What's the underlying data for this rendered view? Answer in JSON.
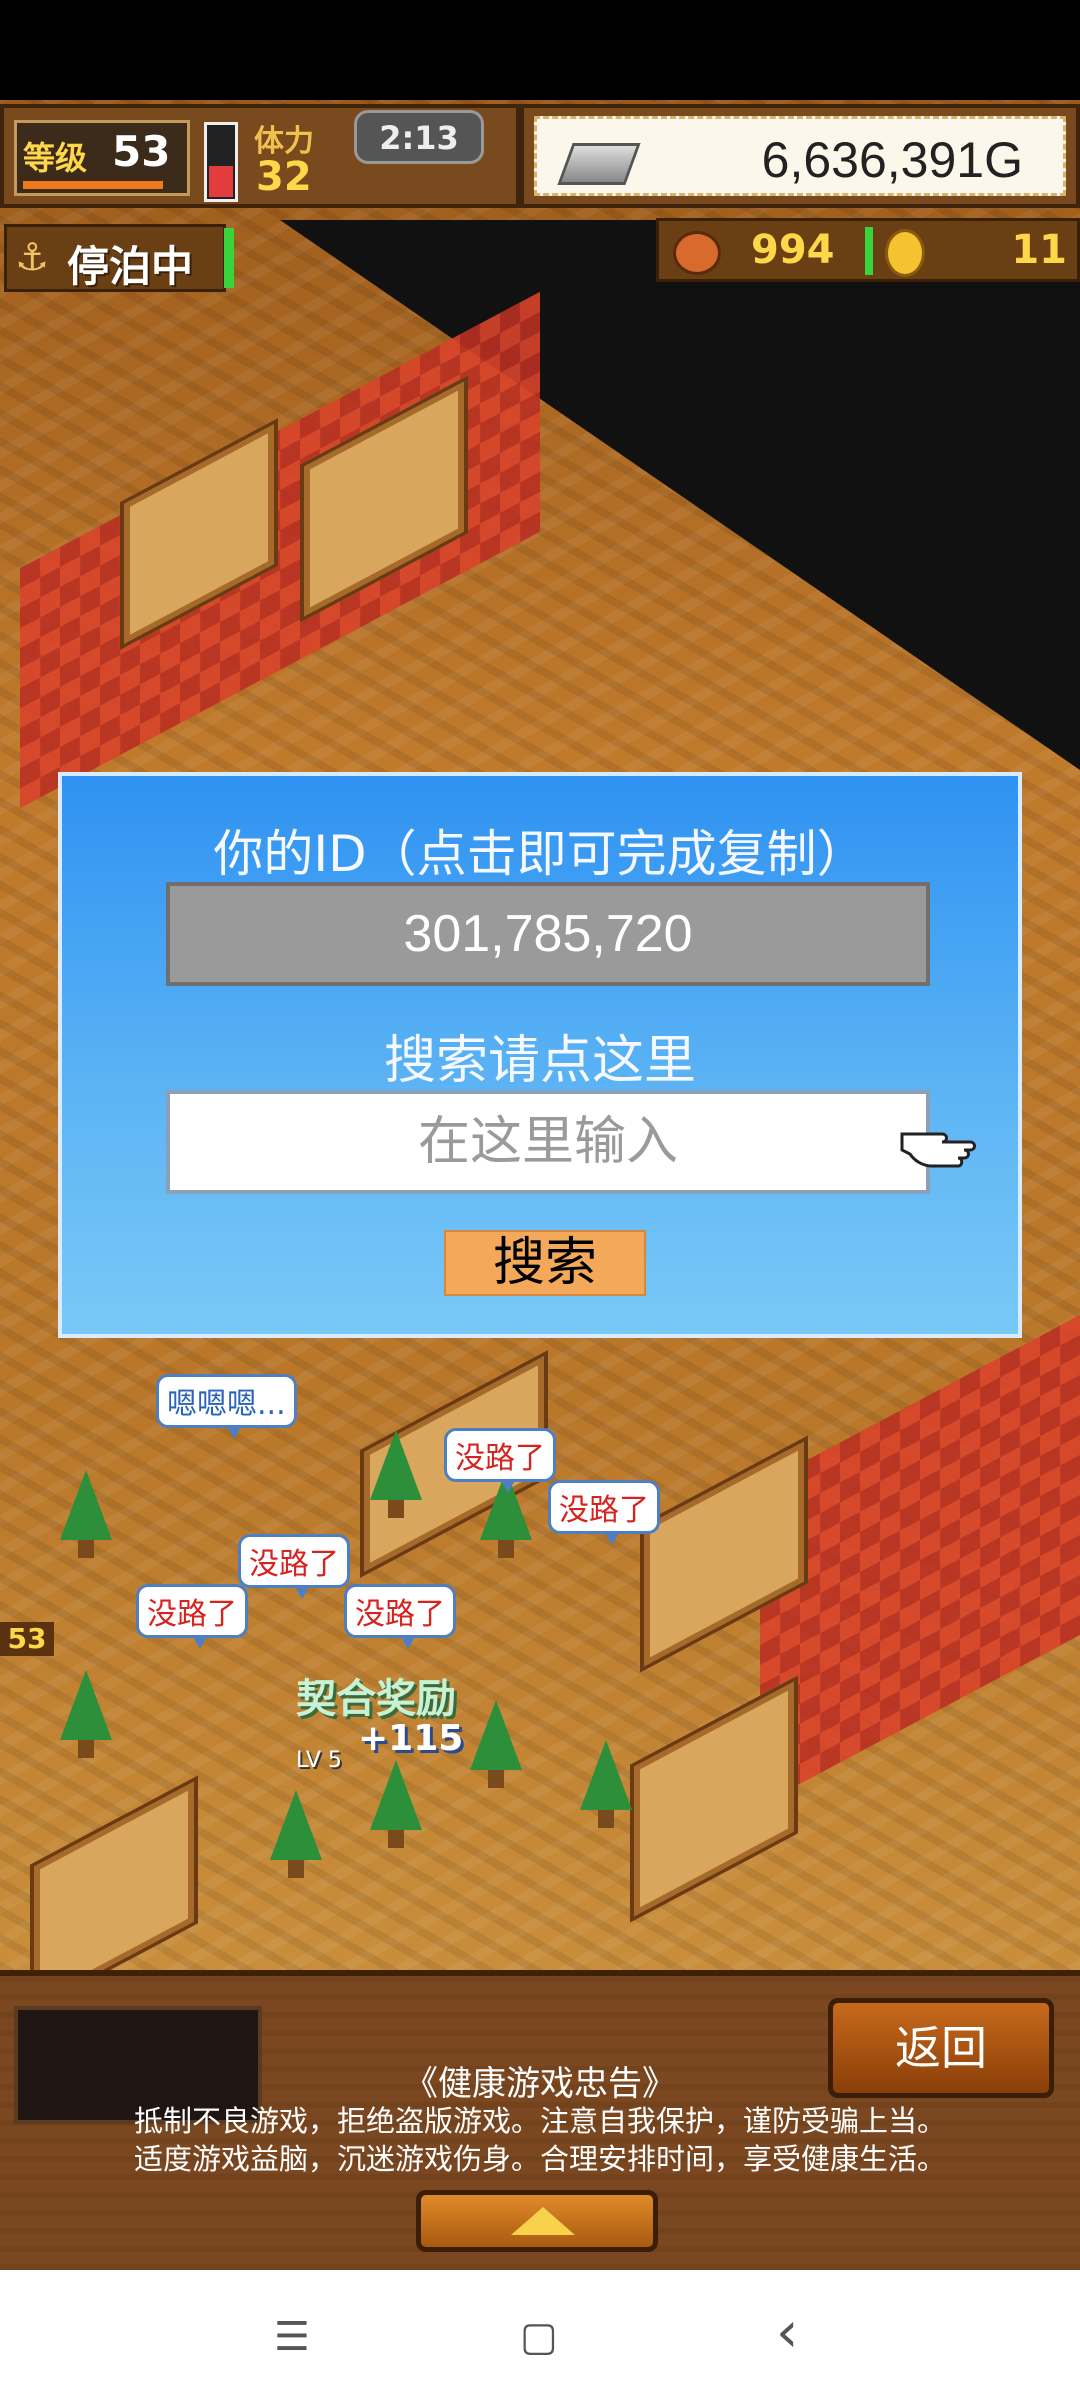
{
  "hud": {
    "level_label": "等级",
    "level_value": "53",
    "stamina_label": "体力",
    "stamina_value": "32",
    "timer": "2:13",
    "gold": "6,636,391G",
    "dock_status": "停泊中",
    "resource1": "994",
    "resource2": "11"
  },
  "dialog": {
    "title": "你的ID（点击即可完成复制）",
    "id_value": "301,785,720",
    "search_title": "搜索请点这里",
    "input_placeholder": "在这里输入",
    "search_button": "搜索"
  },
  "scene": {
    "bubbles": [
      "嗯嗯嗯...",
      "没路了",
      "没路了",
      "没路了",
      "没路了",
      "没路了"
    ],
    "reward_label": "契合奖励",
    "reward_value": "+115",
    "level_tag": "LV 5",
    "side_badge": "53"
  },
  "bottom": {
    "back_button": "返回",
    "health_title": "《健康游戏忠告》",
    "health_line1": "抵制不良游戏，拒绝盗版游戏。注意自我保护，谨防受骗上当。",
    "health_line2": "适度游戏益脑，沉迷游戏伤身。合理安排时间，享受健康生活。"
  },
  "navbar": {
    "menu_icon": "☰",
    "home_icon": "▢",
    "back_icon": "‹"
  }
}
